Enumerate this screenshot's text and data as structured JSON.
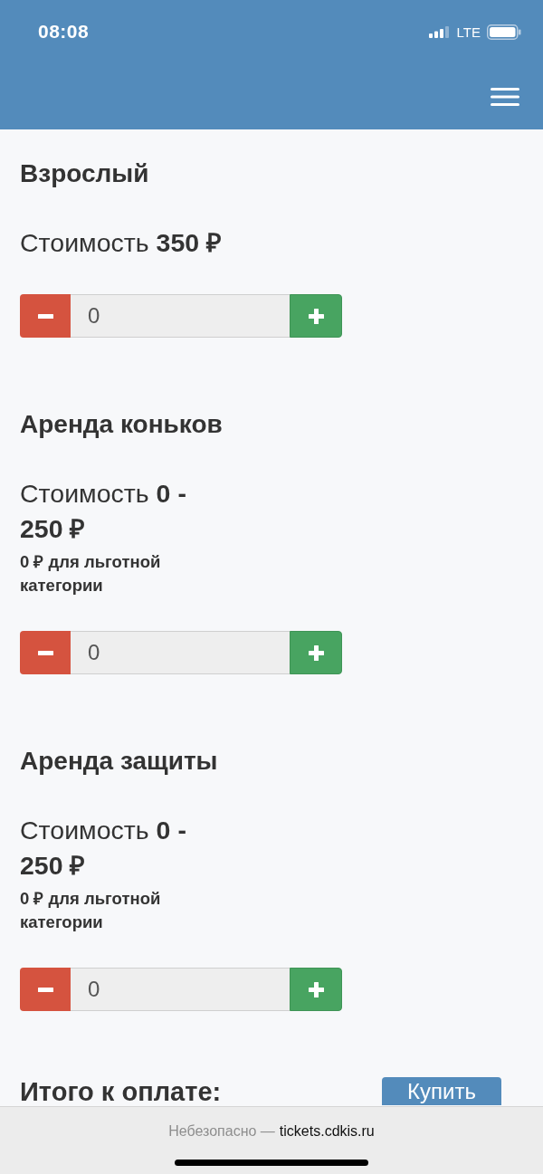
{
  "status_bar": {
    "time": "08:08",
    "network": "LTE"
  },
  "products": [
    {
      "title": "Взрослый",
      "price": "Стоимость **350 ₽**",
      "quantity": "0"
    },
    {
      "title": "Аренда коньков",
      "price": "Стоимость **0 - 250 ₽**",
      "note": "0 ₽ для льготной категории",
      "quantity": "0"
    },
    {
      "title": "Аренда защиты",
      "price": "Стоимость **0 - 250 ₽**",
      "note": "0 ₽ для льготной категории",
      "quantity": "0"
    }
  ],
  "total": {
    "label": "Итого к оплате:",
    "buy_button": "Купить"
  },
  "browser_bar": {
    "security": "Небезопасно —",
    "domain": "tickets.cdkis.ru"
  }
}
